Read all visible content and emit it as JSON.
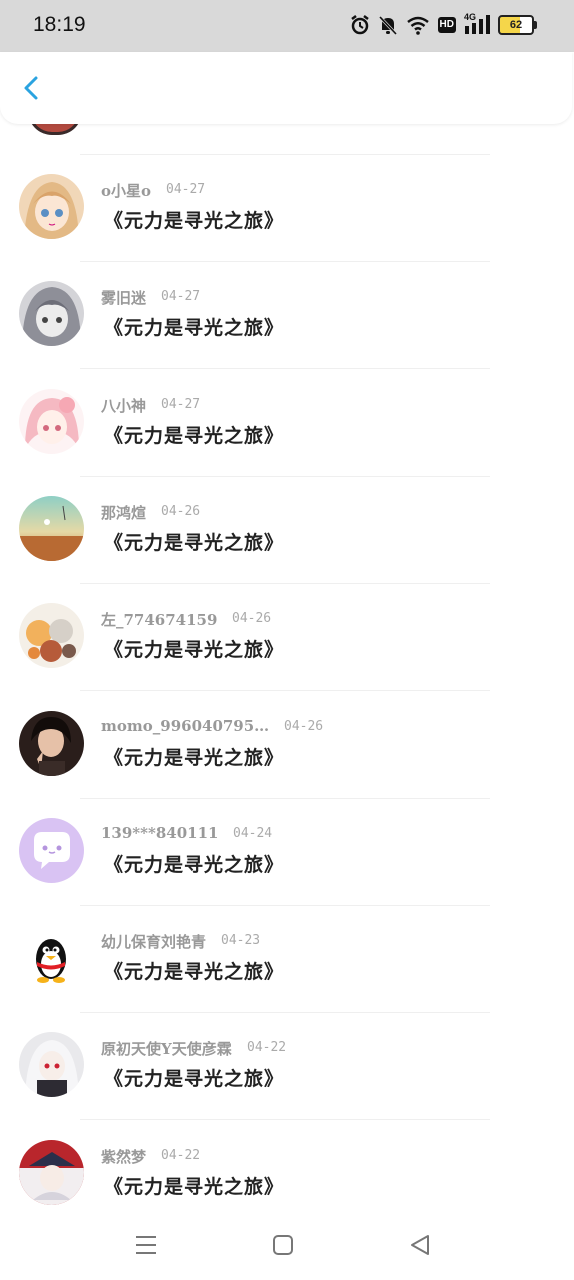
{
  "status_bar": {
    "time": "18:19",
    "icons": [
      "alarm-icon",
      "mute-icon",
      "wifi-icon",
      "hd-icon",
      "signal-4g-icon",
      "battery-icon"
    ],
    "hd_label": "HD",
    "network_label": "4G",
    "battery_level": "62"
  },
  "header": {
    "back_icon": "back-chevron-icon",
    "accent_color": "#2aa3e0"
  },
  "items": [
    {
      "name": "o小星o",
      "date": "04-27",
      "title": "《元力是寻光之旅》",
      "avatar": "anime-girl-blonde"
    },
    {
      "name": "雾旧迷",
      "date": "04-27",
      "title": "《元力是寻光之旅》",
      "avatar": "anime-girl-gray"
    },
    {
      "name": "八小神",
      "date": "04-27",
      "title": "《元力是寻光之旅》",
      "avatar": "anime-girl-pink"
    },
    {
      "name": "那鸿煊",
      "date": "04-26",
      "title": "《元力是寻光之旅》",
      "avatar": "sunset-landscape"
    },
    {
      "name": "左_774674159",
      "date": "04-26",
      "title": "《元力是寻光之旅》",
      "avatar": "anime-collage"
    },
    {
      "name": "momo_996040795…",
      "date": "04-26",
      "title": "《元力是寻光之旅》",
      "avatar": "photo-girl"
    },
    {
      "name": "139***840111",
      "date": "04-24",
      "title": "《元力是寻光之旅》",
      "avatar": "chat-bubble-default"
    },
    {
      "name": "幼儿保育刘艳青",
      "date": "04-23",
      "title": "《元力是寻光之旅》",
      "avatar": "qq-penguin"
    },
    {
      "name": "原初天使Y天使彦霖",
      "date": "04-22",
      "title": "《元力是寻光之旅》",
      "avatar": "anime-white-hair"
    },
    {
      "name": "紫然梦",
      "date": "04-22",
      "title": "《元力是寻光之旅》",
      "avatar": "anime-captain"
    }
  ],
  "nav_bar": {
    "icons": [
      "menu-icon",
      "home-icon",
      "back-icon"
    ]
  }
}
